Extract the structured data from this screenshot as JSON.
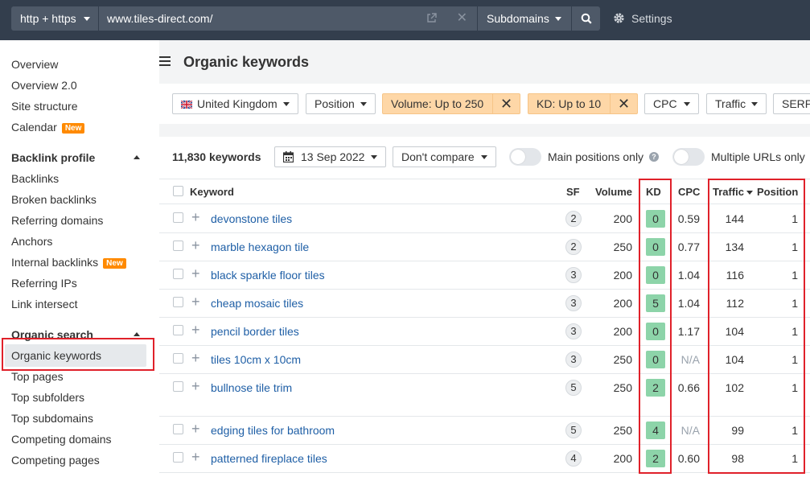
{
  "topbar": {
    "protocol": "http + https",
    "url": "www.tiles-direct.com/",
    "mode": "Subdomains",
    "settings_label": "Settings"
  },
  "sidebar": {
    "items_top": [
      {
        "label": "Overview"
      },
      {
        "label": "Overview 2.0"
      },
      {
        "label": "Site structure"
      },
      {
        "label": "Calendar",
        "badge": "New"
      }
    ],
    "backlink_heading": "Backlink profile",
    "backlink_items": [
      {
        "label": "Backlinks"
      },
      {
        "label": "Broken backlinks"
      },
      {
        "label": "Referring domains"
      },
      {
        "label": "Anchors"
      },
      {
        "label": "Internal backlinks",
        "badge": "New"
      },
      {
        "label": "Referring IPs"
      },
      {
        "label": "Link intersect"
      }
    ],
    "organic_heading": "Organic search",
    "organic_items": [
      {
        "label": "Organic keywords",
        "active": true
      },
      {
        "label": "Top pages"
      },
      {
        "label": "Top subfolders"
      },
      {
        "label": "Top subdomains"
      },
      {
        "label": "Competing domains"
      },
      {
        "label": "Competing pages"
      }
    ]
  },
  "main": {
    "title": "Organic keywords",
    "filters": {
      "country": "United Kingdom",
      "position": "Position",
      "volume": "Volume: Up to 250",
      "kd": "KD: Up to 10",
      "cpc": "CPC",
      "traffic": "Traffic",
      "serp": "SERP"
    },
    "keyword_count": "11,830 keywords",
    "date": "13 Sep 2022",
    "compare": "Don't compare",
    "main_positions_label": "Main positions only",
    "multiple_urls_label": "Multiple URLs only",
    "columns": {
      "keyword": "Keyword",
      "sf": "SF",
      "volume": "Volume",
      "kd": "KD",
      "cpc": "CPC",
      "traffic": "Traffic",
      "position": "Position"
    },
    "rows": [
      {
        "keyword": "devonstone tiles",
        "sf": "2",
        "volume": "200",
        "kd": "0",
        "cpc": "0.59",
        "traffic": "144",
        "position": "1"
      },
      {
        "keyword": "marble hexagon tile",
        "sf": "2",
        "volume": "250",
        "kd": "0",
        "cpc": "0.77",
        "traffic": "134",
        "position": "1"
      },
      {
        "keyword": "black sparkle floor tiles",
        "sf": "3",
        "volume": "200",
        "kd": "0",
        "cpc": "1.04",
        "traffic": "116",
        "position": "1"
      },
      {
        "keyword": "cheap mosaic tiles",
        "sf": "3",
        "volume": "200",
        "kd": "5",
        "cpc": "1.04",
        "traffic": "112",
        "position": "1"
      },
      {
        "keyword": "pencil border tiles",
        "sf": "3",
        "volume": "200",
        "kd": "0",
        "cpc": "1.17",
        "traffic": "104",
        "position": "1"
      },
      {
        "keyword": "tiles 10cm x 10cm",
        "sf": "3",
        "volume": "250",
        "kd": "0",
        "cpc": "N/A",
        "traffic": "104",
        "position": "1"
      },
      {
        "keyword": "bullnose tile trim",
        "sf": "5",
        "volume": "250",
        "kd": "2",
        "cpc": "0.66",
        "traffic": "102",
        "position": "1"
      },
      {
        "keyword": "edging tiles for bathroom",
        "sf": "5",
        "volume": "250",
        "kd": "4",
        "cpc": "N/A",
        "traffic": "99",
        "position": "1"
      },
      {
        "keyword": "patterned fireplace tiles",
        "sf": "4",
        "volume": "200",
        "kd": "2",
        "cpc": "0.60",
        "traffic": "98",
        "position": "1"
      }
    ]
  },
  "colors": {
    "topbar": "#333e4d",
    "kd_badge": "#8dd4a9",
    "active_filter": "#fed7a7",
    "highlight": "#e0212a",
    "new_badge": "#ff8a00",
    "link": "#1f5fa6"
  }
}
